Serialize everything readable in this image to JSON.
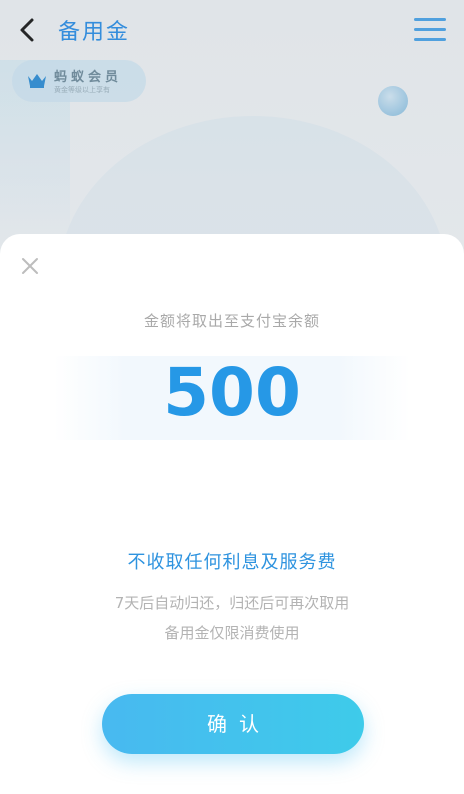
{
  "header": {
    "title": "备用金",
    "back_icon": "chevron-left-icon",
    "menu_icon": "hamburger-menu-icon"
  },
  "member_badge": {
    "title": "蚂蚁会员",
    "subtitle": "黄金等级以上享有",
    "icon": "crown-icon"
  },
  "sheet": {
    "close_icon": "close-icon",
    "prompt": "金额将取出至支付宝余额",
    "amount": "500",
    "fee_notice": "不收取任何利息及服务费",
    "info_line_1": "7天后自动归还，归还后可再次取用",
    "info_line_2": "备用金仅限消费使用",
    "confirm_label": "确认"
  },
  "colors": {
    "accent": "#2698e6",
    "title": "#2b8fe8",
    "button_start": "#48b9f0",
    "button_end": "#3ecbea",
    "muted_text": "#b3b3b3"
  }
}
